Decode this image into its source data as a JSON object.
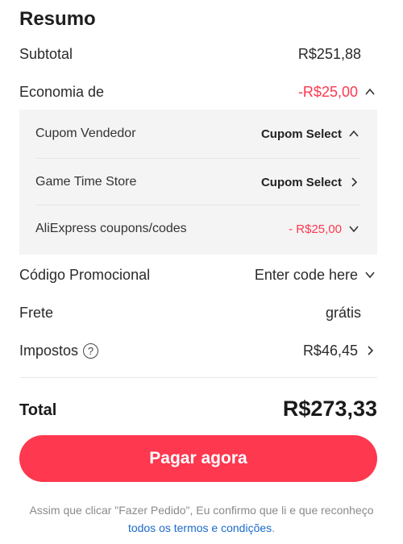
{
  "summary": {
    "title": "Resumo",
    "subtotal": {
      "label": "Subtotal",
      "value": "R$251,88"
    },
    "savings": {
      "label": "Economia de",
      "value": "-R$25,00"
    },
    "coupons": [
      {
        "label": "Cupom Vendedor",
        "value": "Cupom Select"
      },
      {
        "label": "Game Time Store",
        "value": "Cupom Select"
      },
      {
        "label": "AliExpress coupons/codes",
        "value": "- R$25,00"
      }
    ],
    "promo": {
      "label": "Código Promocional",
      "value": "Enter code here"
    },
    "shipping": {
      "label": "Frete",
      "value": "grátis"
    },
    "taxes": {
      "label": "Impostos",
      "help": "?",
      "value": "R$46,45"
    },
    "total": {
      "label": "Total",
      "value": "R$273,33"
    },
    "pay_button": "Pagar agora",
    "disclaimer_text": "Assim que clicar \"Fazer Pedido\", Eu confirmo que li e que reconheço ",
    "terms_link": "todos os termos e condições",
    "disclaimer_end": "."
  },
  "colors": {
    "accent": "#fd384f",
    "link": "#1b6ac9",
    "muted": "#8a8a8a",
    "panel": "#f4f4f4"
  },
  "icons": [
    "chevron-up-icon",
    "chevron-right-icon",
    "chevron-down-icon",
    "help-icon"
  ]
}
